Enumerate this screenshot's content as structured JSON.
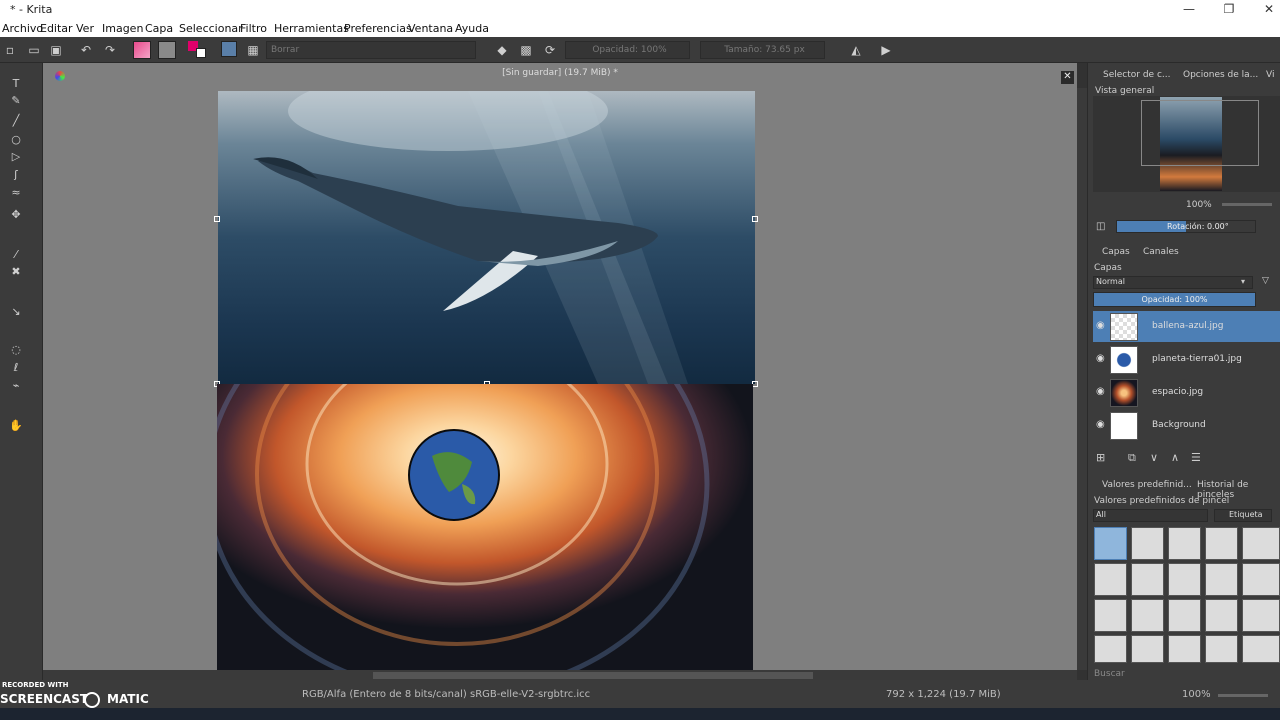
{
  "window": {
    "title": "* - Krita",
    "minimize": "—",
    "maximize": "❐",
    "close": "✕"
  },
  "menu": [
    "Archivo",
    "Editar",
    "Ver",
    "Imagen",
    "Capa",
    "Seleccionar",
    "Filtro",
    "Herramientas",
    "Preferencias",
    "Ventana",
    "Ayuda"
  ],
  "toolbar": {
    "preset_label": "Borrar",
    "opacity_label": "Opacidad: 100%",
    "size_label": "Tamaño: 73.65 px"
  },
  "document": {
    "title": "[Sin guardar]  (19.7 MiB) *"
  },
  "overview": {
    "tab1": "Selector de c...",
    "tab2": "Opciones de la...",
    "tab3": "Vi",
    "label": "Vista general",
    "zoom": "100%",
    "rotation": "Rotación: 0.00°"
  },
  "layers": {
    "tab_layers": "Capas",
    "tab_channels": "Canales",
    "header": "Capas",
    "blend_mode": "Normal",
    "opacity": "Opacidad:  100%",
    "items": [
      {
        "name": "ballena-azul.jpg"
      },
      {
        "name": "planeta-tierra01.jpg"
      },
      {
        "name": "espacio.jpg"
      },
      {
        "name": "Background"
      }
    ]
  },
  "brushes": {
    "tab1": "Valores predefinid...",
    "tab2": "Historial de pinceles",
    "label": "Valores predefinidos de pincel",
    "filter": "All",
    "tag": "Etiqueta",
    "search": "Buscar"
  },
  "status": {
    "color_info": "RGB/Alfa (Entero de 8 bits/canal)  sRGB-elle-V2-srgbtrc.icc",
    "image_info": "792 x 1,224 (19.7 MiB)",
    "zoom": "100%"
  },
  "watermark": {
    "line1": "RECORDED WITH",
    "line2": "SCREENCAST",
    "line3": "MATIC"
  }
}
